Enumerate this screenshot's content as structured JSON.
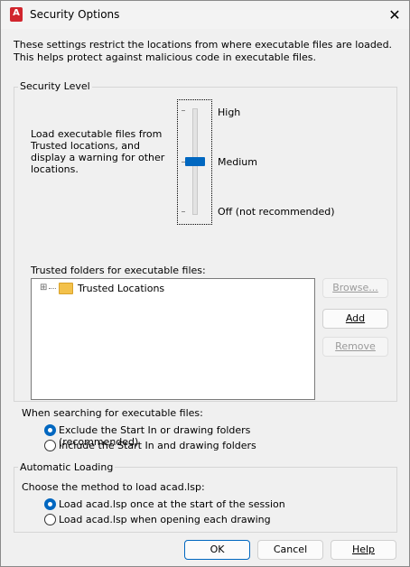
{
  "window": {
    "title": "Security Options",
    "app_icon": "A",
    "close_glyph": "✕"
  },
  "description": "These settings restrict the locations from where executable files are loaded.  This helps protect against malicious code in executable files.",
  "security_level": {
    "legend": "Security Level",
    "explanation": "Load executable files from Trusted locations, and display a warning for other locations.",
    "levels": [
      "High",
      "Medium",
      "Off (not recommended)"
    ],
    "selected": "Medium"
  },
  "trusted": {
    "label": "Trusted folders for executable files:",
    "tree_items": [
      {
        "expander": "⊞",
        "label": "Trusted Locations"
      }
    ],
    "buttons": {
      "browse": "Browse...",
      "add": "Add",
      "remove": "Remove"
    }
  },
  "search": {
    "label": "When searching for executable files:",
    "options": [
      "Exclude the Start In or drawing folders (recommended)",
      "Include the Start In and drawing folders"
    ],
    "selected_index": 0
  },
  "autoload": {
    "legend": "Automatic Loading",
    "label": "Choose the method to load acad.lsp:",
    "options": [
      "Load acad.lsp once at the start of the session",
      "Load acad.lsp when opening each drawing"
    ],
    "selected_index": 0
  },
  "footer": {
    "ok": "OK",
    "cancel": "Cancel",
    "help": "Help"
  },
  "colors": {
    "accent": "#0067c0",
    "app_red": "#d1252d"
  }
}
